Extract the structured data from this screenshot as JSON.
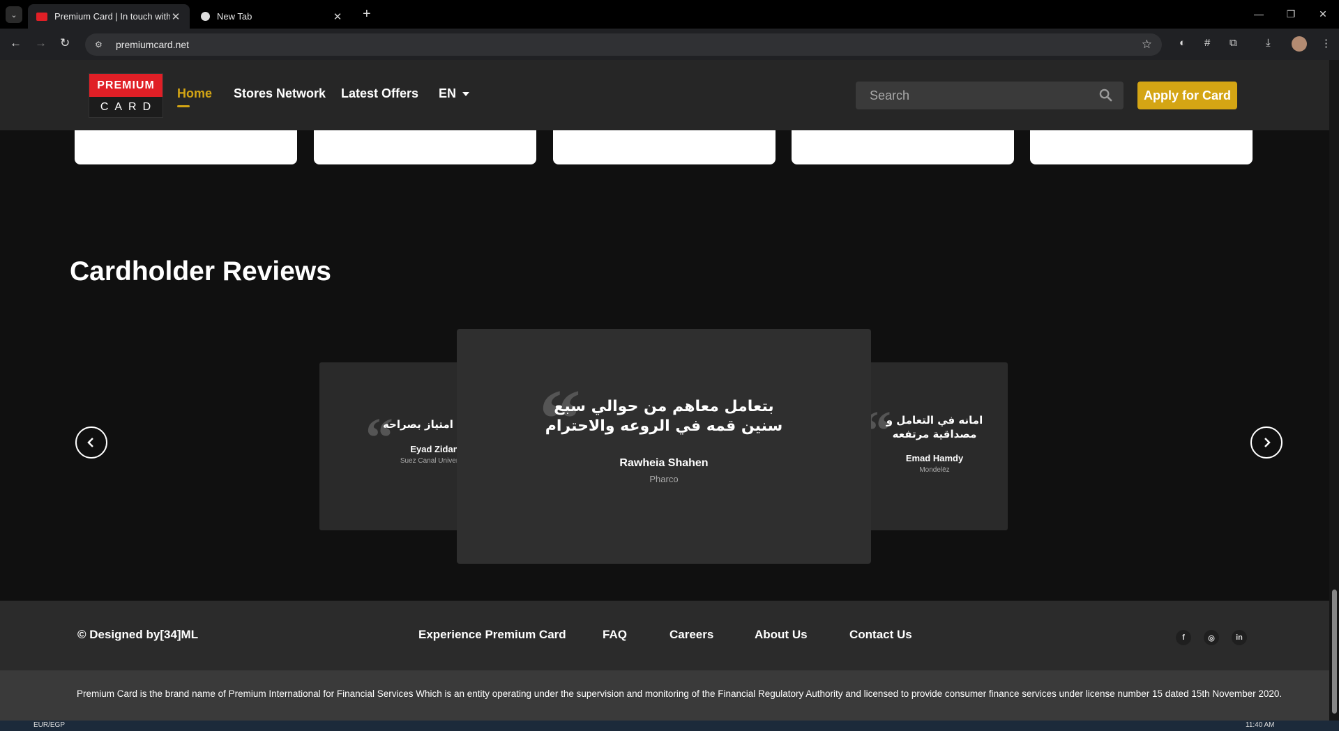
{
  "browser": {
    "tabs": [
      {
        "title": "Premium Card | In touch with y",
        "active": true
      },
      {
        "title": "New Tab",
        "active": false
      }
    ],
    "url": "premiumcard.net"
  },
  "header": {
    "logo_top": "PREMIUM",
    "logo_bottom": "CARD",
    "nav": [
      {
        "label": "Home",
        "active": true
      },
      {
        "label": "Stores Network",
        "active": false
      },
      {
        "label": "Latest Offers",
        "active": false
      },
      {
        "label": "EN",
        "active": false
      }
    ],
    "search_placeholder": "Search",
    "apply_label": "Apply for Card",
    "accent_color": "#d4a514"
  },
  "reviews": {
    "title": "Cardholder Reviews",
    "items": [
      {
        "text": "شركه امتياز بصراحه",
        "name": "Eyad Zidan",
        "company": "Suez Canal University"
      },
      {
        "text": "بتعامل معاهم من حوالي سبع سنين قمه في الروعه والاحترام",
        "name": "Rawheia Shahen",
        "company": "Pharco"
      },
      {
        "text": "امانه في التعامل و مصداقية مرتفعه",
        "name": "Emad Hamdy",
        "company": "Mondelēz"
      }
    ]
  },
  "footer": {
    "copyright": "© Designed by[34]ML",
    "links": [
      "Experience Premium Card",
      "FAQ",
      "Careers",
      "About Us",
      "Contact Us"
    ],
    "legal": "Premium Card is the brand name of Premium International for Financial Services Which is an entity operating under the supervision and monitoring of the Financial Regulatory Authority and licensed to provide consumer finance services under license number 15 dated 15th November 2020."
  },
  "taskbar": {
    "currency": "EUR/EGP",
    "time": "11:40 AM"
  }
}
